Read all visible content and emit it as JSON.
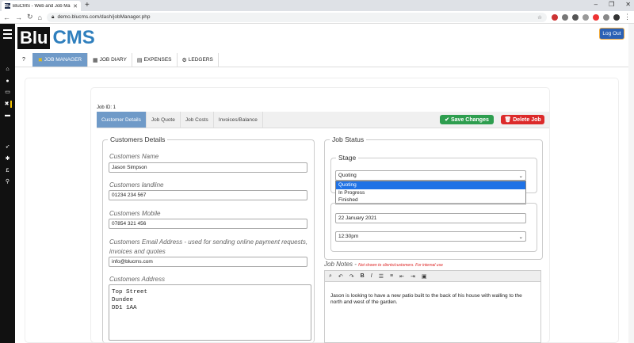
{
  "browser": {
    "tab_title": "BluCMS - Web and Job Manager",
    "favicon": "Blu",
    "url": "demo.blucms.com/dash/jobManager.php",
    "window_controls": [
      "–",
      "❐",
      "✕"
    ]
  },
  "header": {
    "logo_left": "Blu",
    "logo_right": "CMS",
    "logout_label": "Log Out"
  },
  "nav": {
    "help_icon": "?",
    "items": [
      {
        "label": "JOB MANAGER",
        "icon": "✖"
      },
      {
        "label": "JOB DIARY",
        "icon": "▦"
      },
      {
        "label": "EXPENSES",
        "icon": "▤"
      },
      {
        "label": "LEDGERS",
        "icon": "⚙"
      }
    ]
  },
  "job": {
    "id_label": "Job ID: 1",
    "tabs": [
      "Customer Details",
      "Job Quote",
      "Job Costs",
      "Invoices/Balance"
    ],
    "save_label": "Save Changes",
    "delete_label": "Delete Job"
  },
  "customer": {
    "legend": "Customers Details",
    "name_label": "Customers Name",
    "name_value": "Jason Simpson",
    "landline_label": "Customers landline",
    "landline_value": "01234 234 567",
    "mobile_label": "Customers Mobile",
    "mobile_value": "07854 321 456",
    "email_label": "Customers Email Address - used for sending online payment requests, invoices and quotes",
    "email_value": "info@blucms.com",
    "address_label": "Customers Address",
    "address_lines": [
      "Top Street",
      "Dundee",
      "DD1 1AA"
    ]
  },
  "status": {
    "legend": "Job Status",
    "stage_legend": "Stage",
    "stage_value": "Quoting",
    "stage_options": [
      "Quoting",
      "In Progress",
      "Finished"
    ],
    "date_value": "22 January 2021",
    "time_value": "12:30pm"
  },
  "notes": {
    "label": "Job Notes - ",
    "hint": "Not shown to clients/customers. For internal use",
    "toolbar": [
      "⌕",
      "↶",
      "↷",
      "B",
      "I",
      "☰",
      "≡",
      "⇤",
      "⇥",
      "▣"
    ],
    "body": "Jason is looking to have a new patio built to the back of his house with walling to the north and west of the garden."
  }
}
